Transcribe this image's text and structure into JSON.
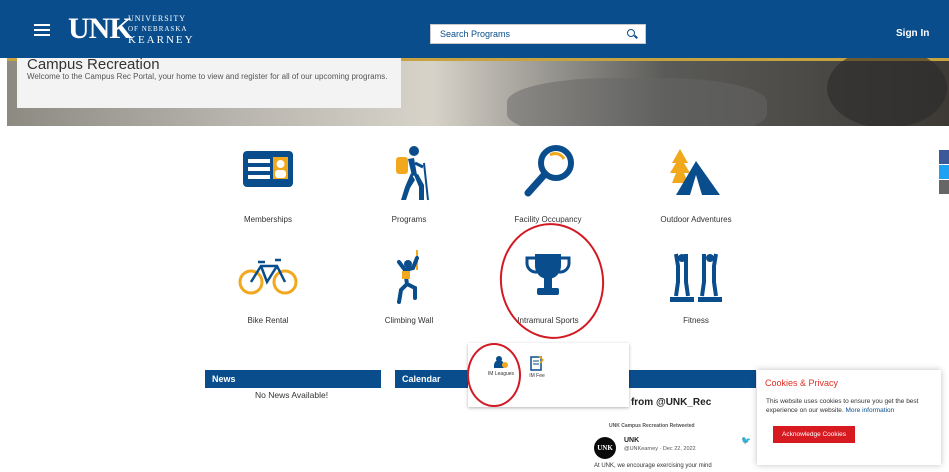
{
  "header": {
    "logo_mark": "UNK",
    "logo_line1": "UNIVERSITY",
    "logo_line2": "OF NEBRASKA",
    "logo_line3": "KEARNEY",
    "search_placeholder": "Search Programs",
    "sign_in": "Sign In",
    "bar_color": "#0a4d8c"
  },
  "hero": {
    "title": "Campus Recreation",
    "description": "Welcome to the Campus Rec Portal, your home to view and register for all of our upcoming programs."
  },
  "tiles": [
    {
      "label": "Memberships",
      "icon": "membership-card-icon"
    },
    {
      "label": "Programs",
      "icon": "hiker-icon"
    },
    {
      "label": "Facility Occupancy",
      "icon": "magnifier-icon"
    },
    {
      "label": "Outdoor Adventures",
      "icon": "tent-icon"
    },
    {
      "label": "Bike Rental",
      "icon": "bicycle-icon"
    },
    {
      "label": "Climbing Wall",
      "icon": "climber-icon"
    },
    {
      "label": "Intramural Sports",
      "icon": "trophy-icon"
    },
    {
      "label": "Fitness",
      "icon": "fitness-icon"
    }
  ],
  "sections": {
    "news_label": "News",
    "news_empty": "No News Available!",
    "calendar_label": "Calendar"
  },
  "dropdown": {
    "im_leagues": "IM Leagues",
    "im_fee": "IM Fee"
  },
  "twitter": {
    "title": "Tweets from @UNK_Rec",
    "retweeted": "UNK Campus Recreation Retweeted",
    "name": "UNK",
    "handle": "@UNKearney · Dec 22, 2022",
    "text": "At UNK, we encourage exercising your mind",
    "avatar_text": "UNK"
  },
  "cookie": {
    "title": "Cookies & Privacy",
    "body": "This website uses cookies to ensure you get the best experience on our website.",
    "more": "More information",
    "button": "Acknowledge Cookies"
  },
  "colors": {
    "primary": "#0a4d8c",
    "accent": "#f2a81d",
    "annotation": "#d21a24",
    "cookie_button": "#d71920"
  }
}
